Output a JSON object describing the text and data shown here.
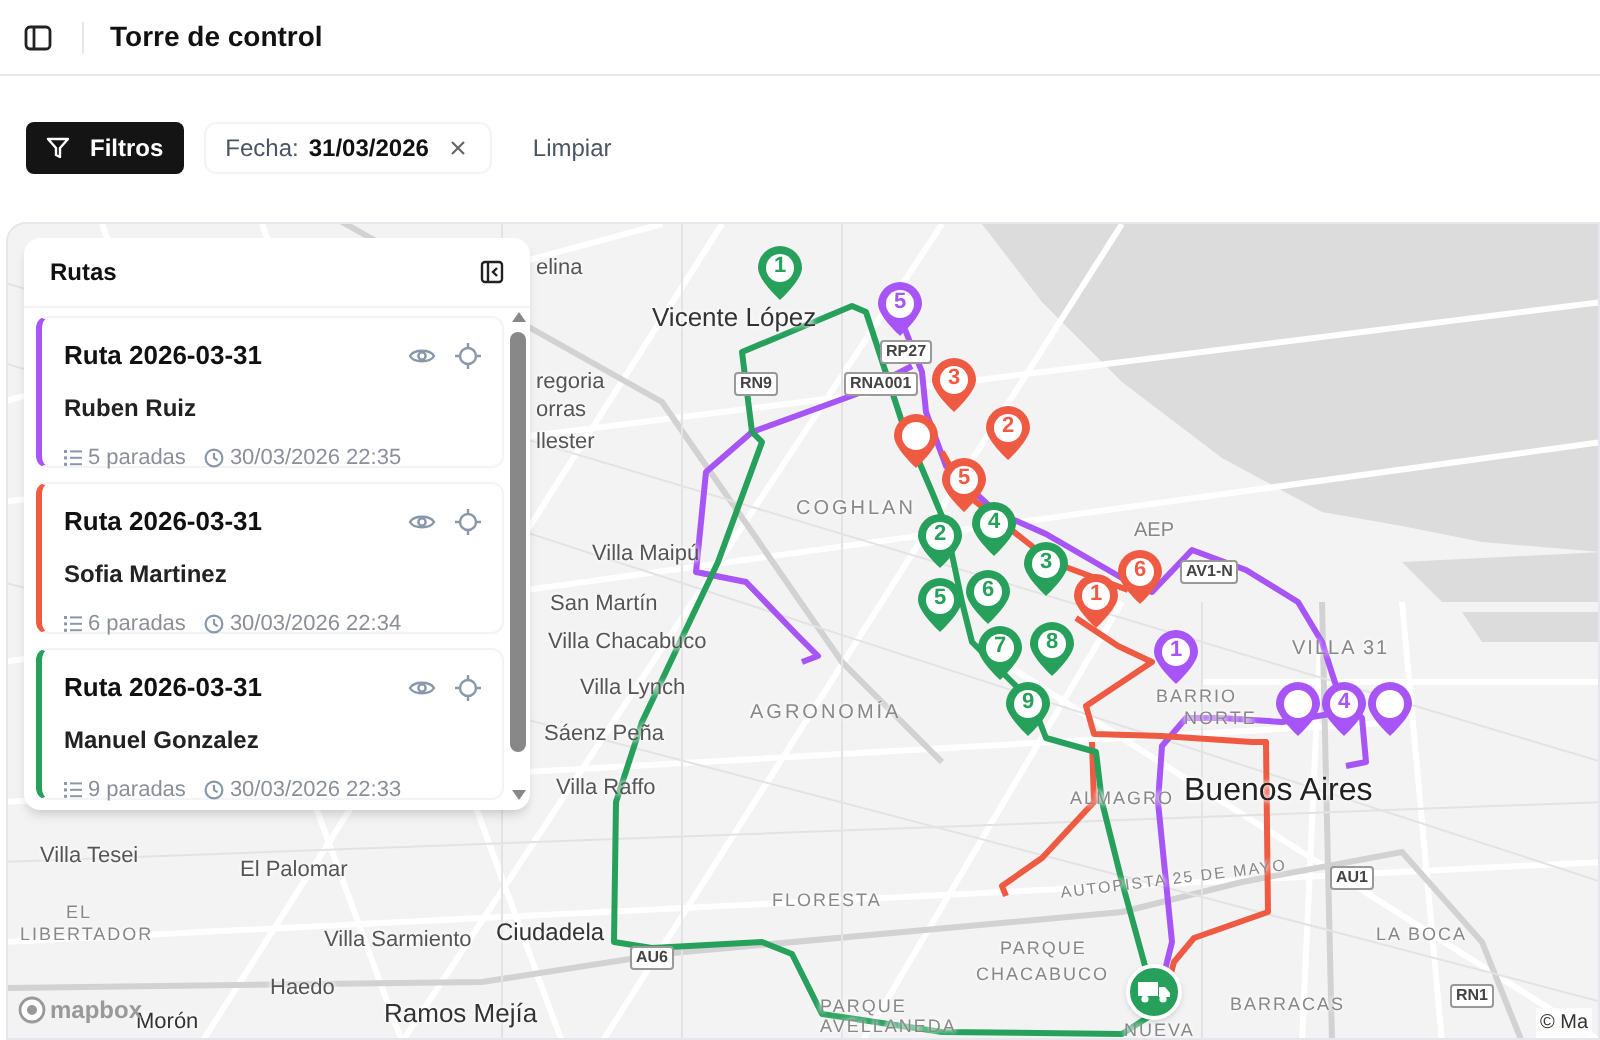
{
  "header": {
    "title": "Torre de control"
  },
  "filters": {
    "button": "Filtros",
    "chip_label": "Fecha:",
    "chip_value": "31/03/2026",
    "clear": "Limpiar"
  },
  "panel": {
    "title": "Rutas",
    "routes": [
      {
        "title": "Ruta 2026-03-31",
        "driver": "Ruben Ruiz",
        "stops": "5 paradas",
        "time": "30/03/2026 22:35",
        "color": "#a855f7"
      },
      {
        "title": "Ruta 2026-03-31",
        "driver": "Sofia Martinez",
        "stops": "6 paradas",
        "time": "30/03/2026 22:34",
        "color": "#ef5a43"
      },
      {
        "title": "Ruta 2026-03-31",
        "driver": "Manuel Gonzalez",
        "stops": "9 paradas",
        "time": "30/03/2026 22:33",
        "color": "#27a05c"
      }
    ]
  },
  "map": {
    "place_labels": [
      "elina",
      "Vicente López",
      "regoria",
      "orras",
      "llester",
      "COGHLAN",
      "Villa Maipú",
      "San Martín",
      "Villa Chacabuco",
      "Villa Lynch",
      "AGRONOMÍA",
      "Sáenz Peña",
      "Villa Raffo",
      "AEP",
      "VILLA 31",
      "BARRIO",
      "NORTE",
      "ALMAGRO",
      "Buenos Aires",
      "AUTOPISTA 25 DE MAYO",
      "FLORESTA",
      "LA BOCA",
      "PARQUE",
      "CHACABUCO",
      "PARQUE",
      "AVELLANEDA",
      "BARRACAS",
      "NUEVA",
      "Villa Tesei",
      "El Palomar",
      "EL",
      "LIBERTADOR",
      "Villa Sarmiento",
      "Ciudadela",
      "Haedo",
      "Morón",
      "Ramos Mejía"
    ],
    "shields": [
      "RN9",
      "RNA001",
      "RP27",
      "AV1-N",
      "AU1",
      "AU6",
      "RN1"
    ],
    "markers": [
      {
        "kind": "stop",
        "label": "1",
        "color": "#27a05c"
      },
      {
        "kind": "stop",
        "label": "5",
        "color": "#a855f7"
      },
      {
        "kind": "stop",
        "label": "3",
        "color": "#ef5a43"
      },
      {
        "kind": "stop",
        "color": "#ef5a43"
      },
      {
        "kind": "stop",
        "label": "2",
        "color": "#ef5a43"
      },
      {
        "kind": "stop",
        "label": "5",
        "color": "#ef5a43"
      },
      {
        "kind": "stop",
        "label": "2",
        "color": "#27a05c"
      },
      {
        "kind": "stop",
        "label": "4",
        "color": "#27a05c"
      },
      {
        "kind": "stop",
        "label": "3",
        "color": "#27a05c"
      },
      {
        "kind": "stop",
        "label": "6",
        "color": "#ef5a43"
      },
      {
        "kind": "stop",
        "label": "5",
        "color": "#27a05c"
      },
      {
        "kind": "stop",
        "label": "6",
        "color": "#27a05c"
      },
      {
        "kind": "stop",
        "label": "1",
        "color": "#ef5a43"
      },
      {
        "kind": "stop",
        "label": "7",
        "color": "#27a05c"
      },
      {
        "kind": "stop",
        "label": "8",
        "color": "#27a05c"
      },
      {
        "kind": "stop",
        "label": "9",
        "color": "#27a05c"
      },
      {
        "kind": "stop",
        "label": "1",
        "color": "#a855f7"
      },
      {
        "kind": "stop",
        "color": "#a855f7"
      },
      {
        "kind": "stop",
        "color": "#a855f7"
      },
      {
        "kind": "stop",
        "label": "4",
        "color": "#a855f7"
      },
      {
        "kind": "vehicle",
        "color": "#27a05c"
      }
    ],
    "logo": "mapbox",
    "attribution": "© Ma"
  }
}
